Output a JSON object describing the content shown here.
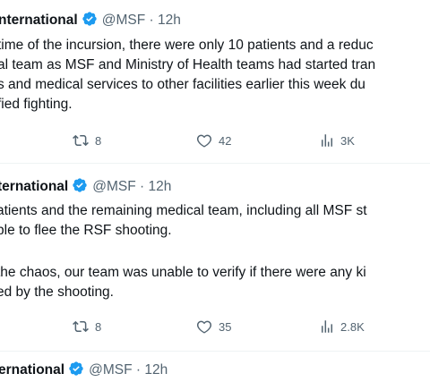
{
  "tweets": [
    {
      "name": "nternational",
      "handle": "@MSF",
      "sep": "·",
      "time": "12h",
      "lines": [
        "time of the incursion, there were only 10 patients and a reduc",
        "al team as MSF and Ministry of Health teams had started tran",
        "s and medical services to other facilities earlier this week du",
        "fied fighting."
      ],
      "retweets": "8",
      "likes": "42",
      "views": "3K"
    },
    {
      "name": "ternational",
      "handle": "@MSF",
      "sep": "·",
      "time": "12h",
      "lines": [
        "atients and the remaining medical team, including all MSF st",
        "ble to flee the RSF shooting.",
        "",
        "the chaos, our team was unable to verify if there were any ki",
        "ed by the shooting."
      ],
      "retweets": "8",
      "likes": "35",
      "views": "2.8K"
    },
    {
      "name": "ernational",
      "handle": "@MSF",
      "sep": "·",
      "time": "12h"
    }
  ],
  "colors": {
    "verified": "#1d9bf0",
    "muted": "#536471",
    "text": "#0f1419"
  }
}
